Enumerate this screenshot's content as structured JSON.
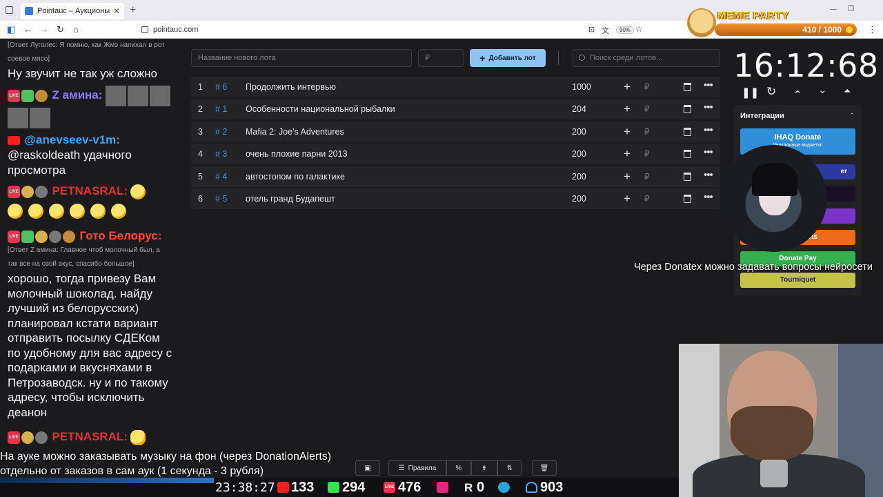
{
  "browser": {
    "tab_title": "Pointauc – Аукционы, лотереи",
    "tab_close": "✕",
    "new_tab": "+",
    "url": "pointauc.com",
    "zoom": "90%"
  },
  "meme_party": {
    "title": "MEME PARTY",
    "score": "410 / 1000"
  },
  "chat": {
    "m1_reply": "[Ответ Луголес: Я помню, как Жмэ напихал в рот",
    "m1_reply2": "соевое мясо]",
    "m1_text": "Ну звучит не так уж сложно",
    "m2_user": "Z амина:",
    "m3_user": "@anevseev-v1m:",
    "m3_text1": "@raskoldeath удачного",
    "m3_text2": "просмотра",
    "m4_user": "PETNASRAL:",
    "m5_user": "Гото Белорус:",
    "m5_reply1": "[Ответ Z амина: Главное чтоб молочный был, а",
    "m5_reply2": "так все на свой вкус, спасибо большое]",
    "m5_lines": [
      "хорошо, тогда привезу Вам",
      "молочный шоколад. найду",
      "лучший из белорусских)",
      "планировал кстати вариант",
      "отправить посылку СДЕКом",
      "по удобному для вас адресу с",
      "подарками и вкусняхами в",
      "Петрозаводск. ну и по такому",
      "адресу, чтобы исключить",
      "деанон"
    ],
    "m6_user": "PETNASRAL:",
    "live_badge": "LIVE"
  },
  "lots_toolbar": {
    "new_lot_placeholder": "Название нового лота",
    "price_placeholder": "₽",
    "add_lot": "Добавить лот",
    "search_placeholder": "Поиск среди лотов..."
  },
  "lots": [
    {
      "idx": "1",
      "hash": "# 6",
      "name": "Продолжить интервью",
      "amount": "1000"
    },
    {
      "idx": "2",
      "hash": "# 1",
      "name": "Особенности национальной рыбалки",
      "amount": "204"
    },
    {
      "idx": "3",
      "hash": "# 2",
      "name": "Mafia 2: Joe's Adventures",
      "amount": "200"
    },
    {
      "idx": "4",
      "hash": "# 3",
      "name": "очень плохие парни 2013",
      "amount": "200"
    },
    {
      "idx": "5",
      "hash": "# 4",
      "name": "автостопом по галактике",
      "amount": "200"
    },
    {
      "idx": "6",
      "hash": "# 5",
      "name": "отель гранд Будапешт",
      "amount": "200"
    }
  ],
  "lot_symbols": {
    "plus": "+",
    "rub": "₽",
    "more": "•••"
  },
  "timer": {
    "value": "16:12:68",
    "pause": "❚❚",
    "reset": "↻",
    "up": "⌃",
    "down": "⌄",
    "top": "⏶"
  },
  "integrations": {
    "title": "Интеграции",
    "ihaq_label": "IHAQ Donate",
    "ihaq_sub": "Уникальные виджеты!",
    "b2_label": "er",
    "b5_label": "Alerts",
    "donatepay_label": "Donate Pay",
    "tourniquet_label": "Tourniquet",
    "colors": {
      "ihaq": "#2f8fd8",
      "b2": "#2c3aa0",
      "b3": "#1a1224",
      "b4": "#7a34c9",
      "alerts": "#ee6a1c",
      "donatepay": "#34b14e",
      "tourniquet": "#c3c348"
    }
  },
  "captions": {
    "donatex": "Через Donatex можно задавать вопросы нейросети",
    "music_line1": "На ауке можно заказывать музыку на фон (через DonationAlerts)",
    "music_line2": "отдельно от заказов в сам аук (1 секунда - 3 рубля)"
  },
  "bottom_toolbar": {
    "rules": "Правила",
    "percent": "%"
  },
  "stats": {
    "time": "23:38:27",
    "youtube": "133",
    "kick": "294",
    "live": "476",
    "rutube": "0",
    "total": "903",
    "rutube_letter": "R"
  }
}
